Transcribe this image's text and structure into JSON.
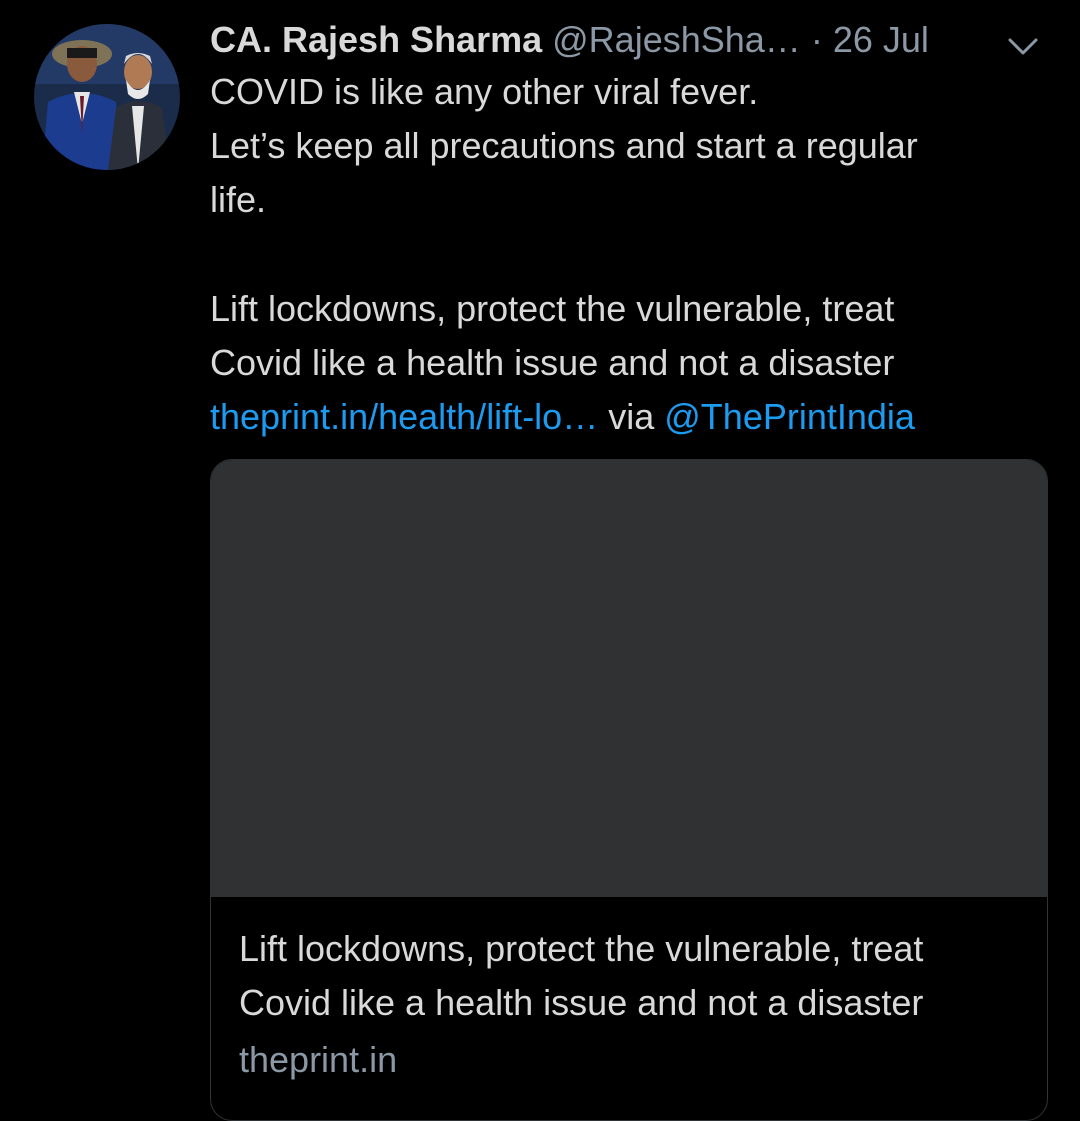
{
  "tweet": {
    "author": {
      "display_name": "CA. Rajesh Sharma",
      "handle": "@RajeshSha…"
    },
    "separator": "·",
    "timestamp": "26 Jul",
    "menu_icon": "chevron-down-icon",
    "avatar_icon": "avatar",
    "body": {
      "line1": "COVID is like any other viral fever.",
      "line2": "Let’s keep all precautions and start a regular",
      "line3": "life.",
      "line4": "Lift lockdowns, protect the vulnerable, treat",
      "line5": "Covid like a health issue and not a disaster",
      "link_text": "theprint.in/health/lift-lo…",
      "via_text": "via",
      "mention": "@ThePrintIndia"
    },
    "card": {
      "title_line1": "Lift lockdowns, protect the vulnerable, treat",
      "title_line2": "Covid like a health issue and not a disaster",
      "domain": "theprint.in"
    }
  },
  "colors": {
    "background": "#000000",
    "text": "#d9d9d9",
    "muted": "#8b98a5",
    "link": "#1d9bf0",
    "card_image": "#2f3133",
    "card_border": "#2f3336"
  }
}
